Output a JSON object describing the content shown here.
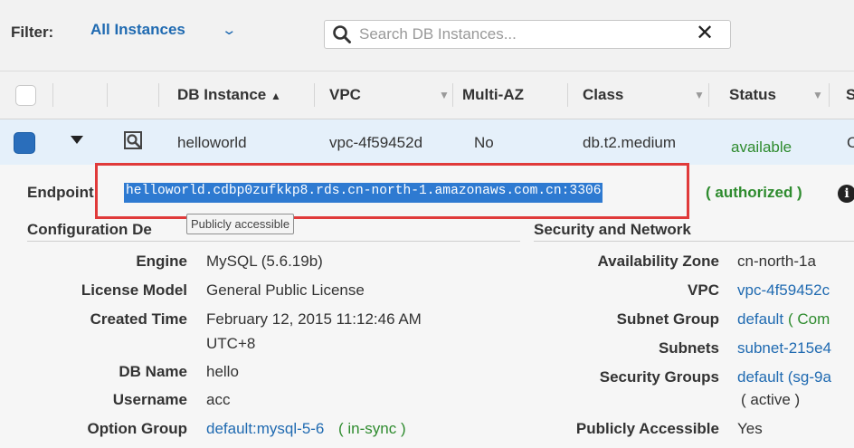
{
  "filter": {
    "label": "Filter:",
    "selected": "All Instances",
    "search_placeholder": "Search DB Instances...",
    "clear_glyph": "✕"
  },
  "table": {
    "headers": {
      "db_instance": "DB Instance",
      "sort_indicator": "▲",
      "vpc": "VPC",
      "multi_az": "Multi-AZ",
      "class": "Class",
      "status": "Status",
      "next": "S"
    },
    "row": {
      "db_instance": "helloworld",
      "vpc": "vpc-4f59452d",
      "multi_az": "No",
      "class": "db.t2.medium",
      "status": "available",
      "next": "C"
    }
  },
  "details": {
    "endpoint_label": "Endpoint:",
    "endpoint_value": "helloworld.cdbp0zufkkp8.rds.cn-north-1.amazonaws.com.cn:3306",
    "endpoint_status": "( authorized )",
    "tooltip": "Publicly accessible",
    "config_title": "Configuration De",
    "security_title": "Security and Network",
    "config": {
      "engine_label": "Engine",
      "engine_value": "MySQL (5.6.19b)",
      "license_label": "License Model",
      "license_value": "General Public License",
      "created_label": "Created Time",
      "created_value_line1": "February 12, 2015 11:12:46 AM",
      "created_value_line2": "UTC+8",
      "dbname_label": "DB Name",
      "dbname_value": "hello",
      "username_label": "Username",
      "username_value": "acc",
      "option_label": "Option Group",
      "option_link": "default:mysql-5-6",
      "option_status": "( in-sync )"
    },
    "security": {
      "az_label": "Availability Zone",
      "az_value": "cn-north-1a",
      "vpc_label": "VPC",
      "vpc_value": "vpc-4f59452c",
      "subnet_group_label": "Subnet Group",
      "subnet_group_link": "default",
      "subnet_group_extra": "( Com",
      "subnets_label": "Subnets",
      "subnets_value": "subnet-215e4",
      "sg_label": "Security Groups",
      "sg_link": "default (sg-9a",
      "sg_status": "( active )",
      "public_label": "Publicly Accessible",
      "public_value": "Yes"
    }
  },
  "colors": {
    "link": "#1f6ab1",
    "status_green": "#2e8b2e",
    "selection": "#2e7ad1",
    "highlight_box": "#e03a3a",
    "selected_row": "#e5f0fa"
  }
}
